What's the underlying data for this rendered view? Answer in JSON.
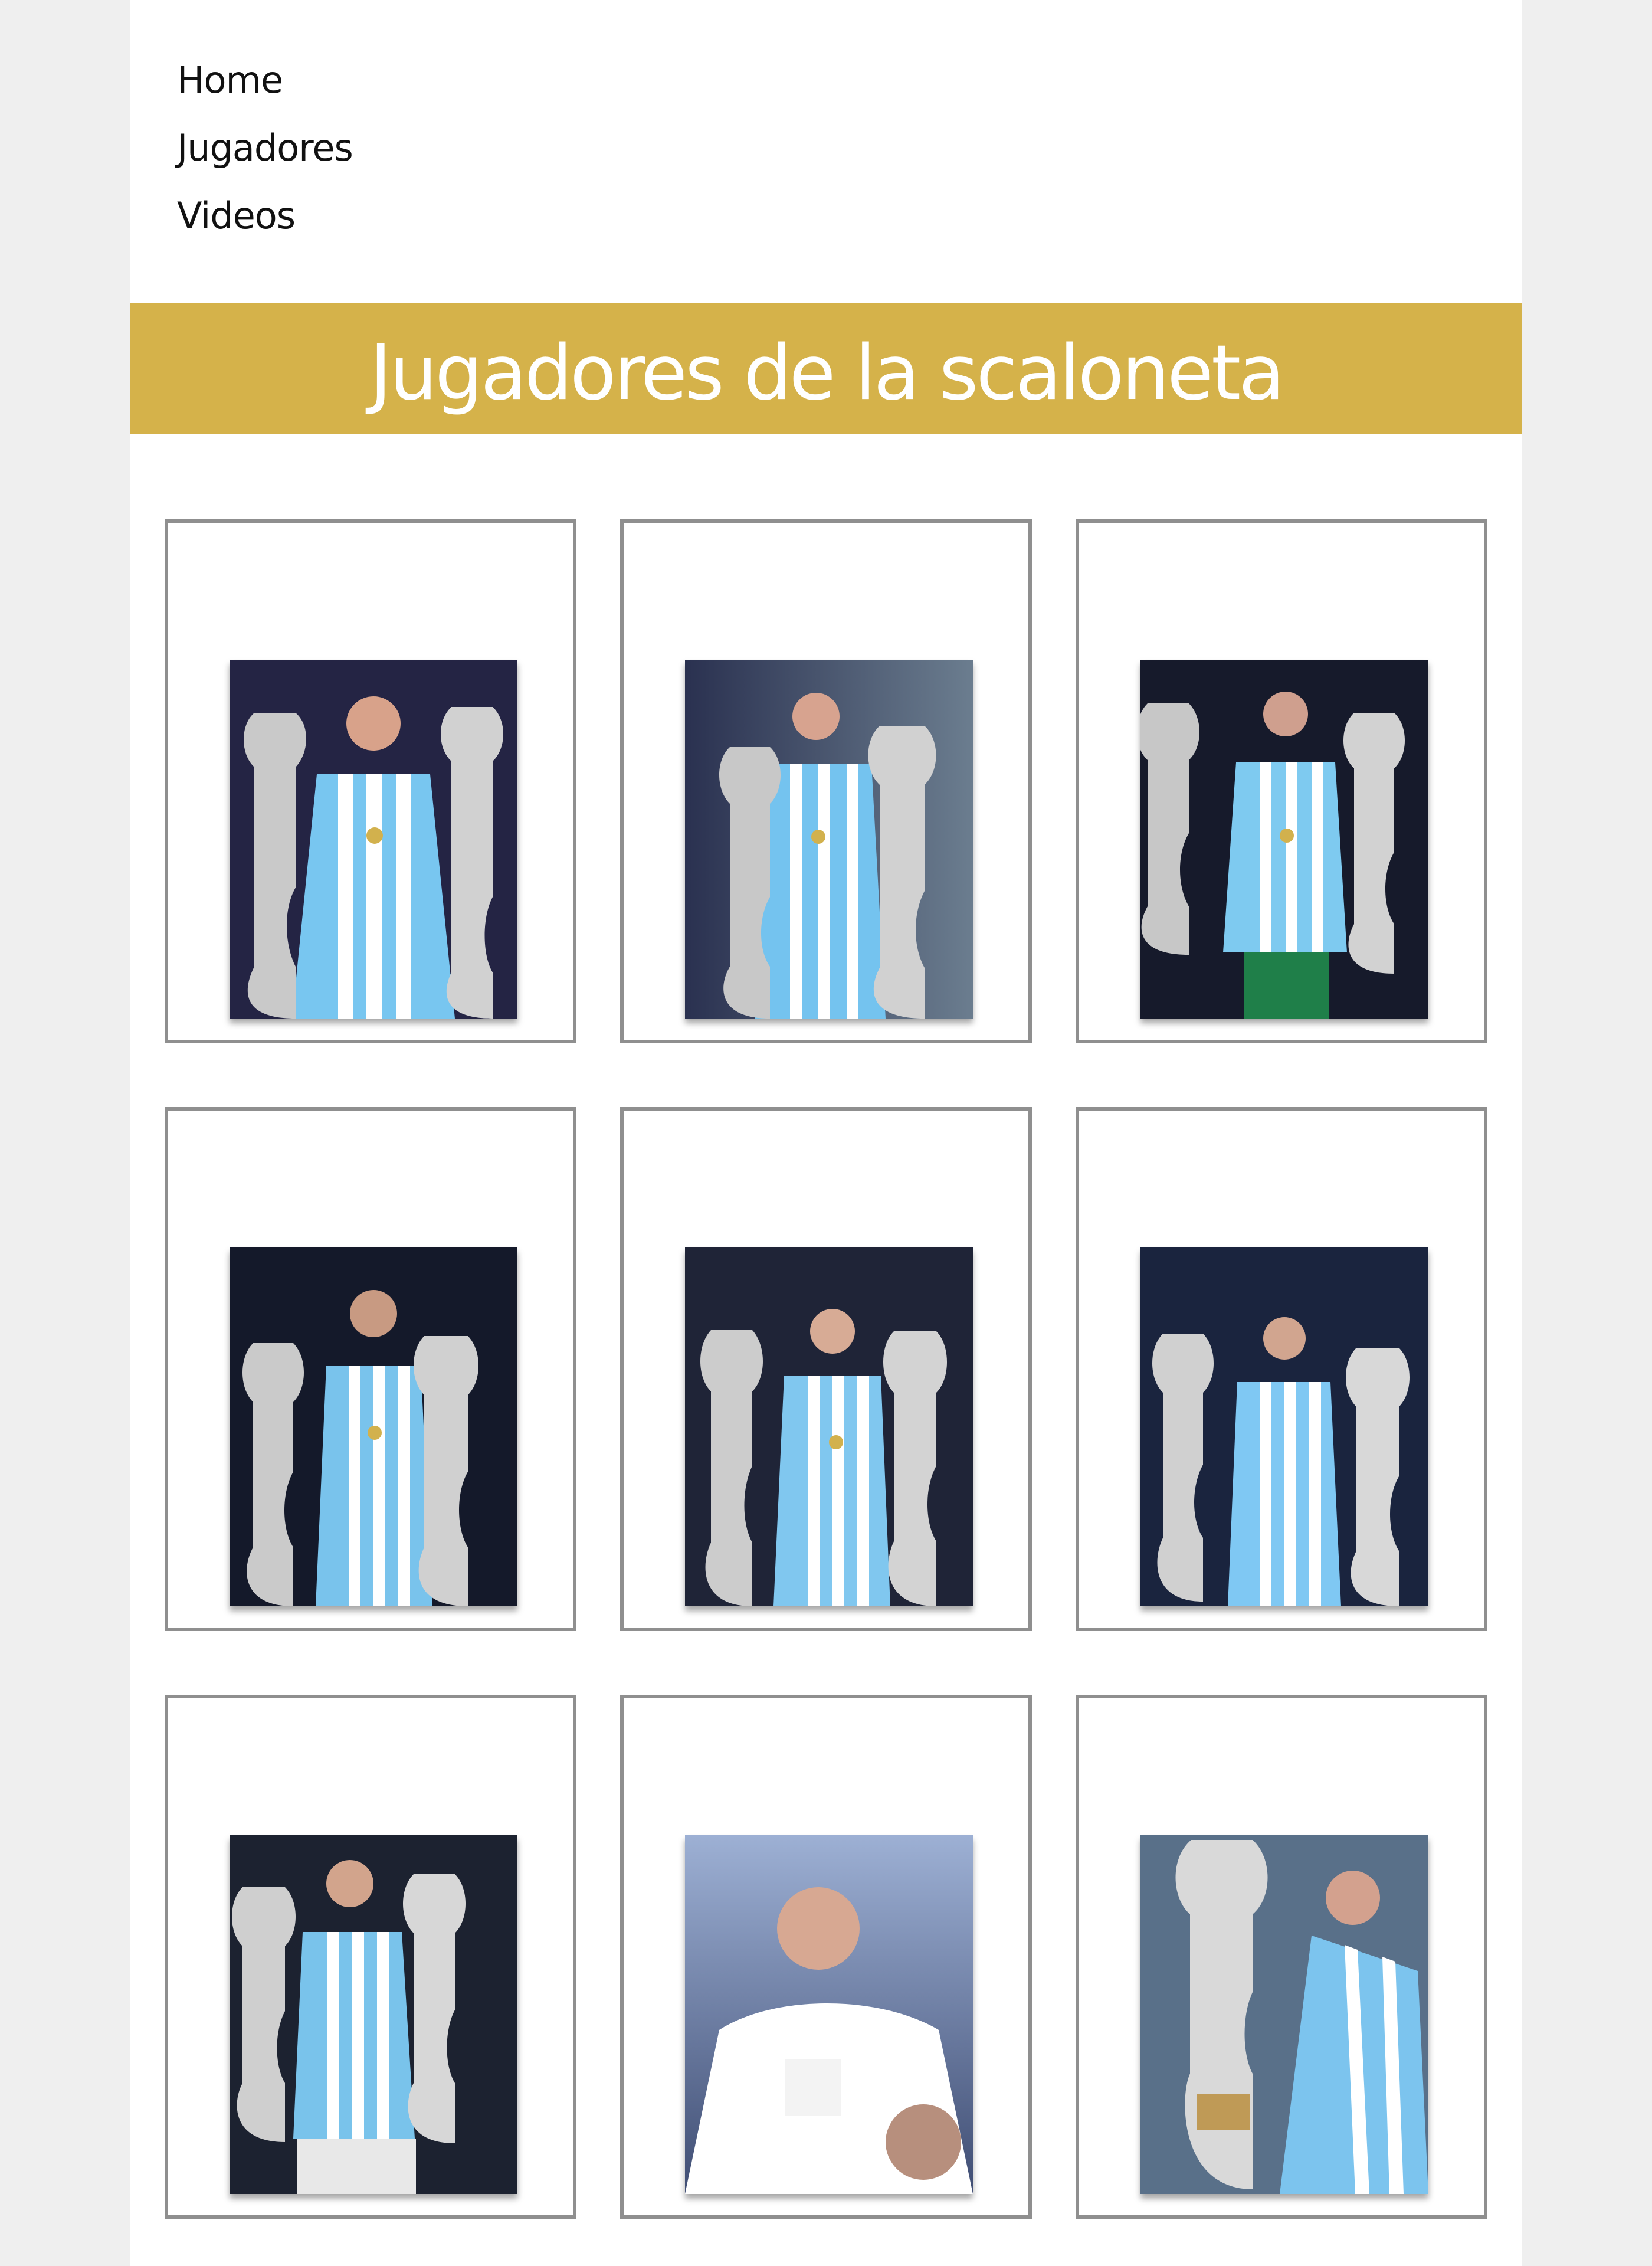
{
  "nav": {
    "items": [
      {
        "label": "Home"
      },
      {
        "label": "Jugadores"
      },
      {
        "label": "Videos"
      }
    ]
  },
  "banner": {
    "title": "Jugadores de la scaloneta"
  },
  "gallery": {
    "cards": [
      {
        "theme": "#242444",
        "shirt": "#78c6f0"
      },
      {
        "theme": "#2b3558",
        "shirt": "#74c3ef"
      },
      {
        "theme": "#161a2b",
        "shirt": "#7ecaf0"
      },
      {
        "theme": "#14192a",
        "shirt": "#79c3ec"
      },
      {
        "theme": "#1f2437",
        "shirt": "#80c7ef"
      },
      {
        "theme": "#1a243e",
        "shirt": "#7fc8f3"
      },
      {
        "theme": "#1c2230",
        "shirt": "#79c3eb"
      },
      {
        "theme": "#3f4d73",
        "shirt": "#ffffff"
      },
      {
        "theme": "#597089",
        "shirt": "#7cc4ee"
      }
    ]
  },
  "colors": {
    "banner": "#d5b24a",
    "border": "#8f8f8f",
    "page_bg": "#efefef"
  }
}
